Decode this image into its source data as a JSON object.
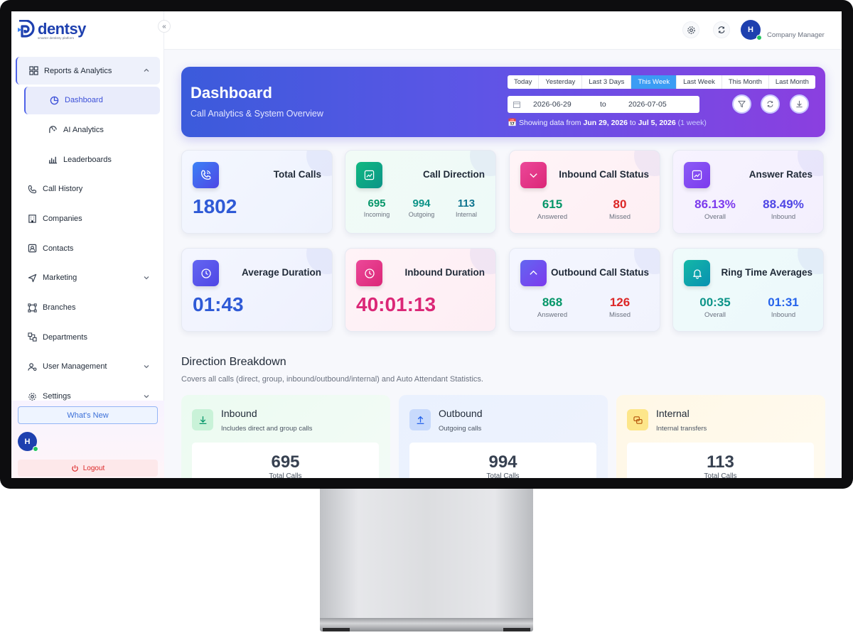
{
  "brand": {
    "name": "dentsy",
    "tagline": "smarter dentistry platform"
  },
  "sidebar": {
    "collapse_icon": "«",
    "items": [
      {
        "label": "Reports & Analytics",
        "icon": "grid-icon",
        "expanded": true
      },
      {
        "label": "Dashboard",
        "icon": "pie-chart-icon",
        "active": true
      },
      {
        "label": "AI Analytics",
        "icon": "ai-icon"
      },
      {
        "label": "Leaderboards",
        "icon": "bar-chart-icon"
      },
      {
        "label": "Call History",
        "icon": "phone-icon"
      },
      {
        "label": "Companies",
        "icon": "building-icon"
      },
      {
        "label": "Contacts",
        "icon": "contact-card-icon"
      },
      {
        "label": "Marketing",
        "icon": "send-icon"
      },
      {
        "label": "Branches",
        "icon": "branches-icon"
      },
      {
        "label": "Departments",
        "icon": "departments-icon"
      },
      {
        "label": "User Management",
        "icon": "user-gear-icon"
      },
      {
        "label": "Settings",
        "icon": "gear-icon"
      }
    ],
    "whats_new": "What's New",
    "avatar_initial": "H",
    "logout": "Logout"
  },
  "topbar": {
    "avatar_initial": "H",
    "role": "Company Manager"
  },
  "hero": {
    "title": "Dashboard",
    "subtitle": "Call Analytics & System Overview",
    "ranges": [
      "Today",
      "Yesterday",
      "Last 3 Days",
      "This Week",
      "Last Week",
      "This Month",
      "Last Month"
    ],
    "selected_range": "This Week",
    "date_from": "2026-06-29",
    "date_to_label": "to",
    "date_to": "2026-07-05",
    "showing_prefix": "Showing data from",
    "showing_from": "Jun 29, 2026",
    "showing_to_word": "to",
    "showing_to": "Jul 5, 2026",
    "showing_span": "(1 week)"
  },
  "cards": {
    "total_calls": {
      "title": "Total Calls",
      "value": "1802"
    },
    "call_direction": {
      "title": "Call Direction",
      "incoming": "695",
      "incoming_label": "Incoming",
      "outgoing": "994",
      "outgoing_label": "Outgoing",
      "internal": "113",
      "internal_label": "Internal"
    },
    "inbound_status": {
      "title": "Inbound Call Status",
      "answered": "615",
      "answered_label": "Answered",
      "missed": "80",
      "missed_label": "Missed"
    },
    "answer_rates": {
      "title": "Answer Rates",
      "overall": "86.13%",
      "overall_label": "Overall",
      "inbound": "88.49%",
      "inbound_label": "Inbound"
    },
    "average_duration": {
      "title": "Average Duration",
      "value": "01:43"
    },
    "inbound_duration": {
      "title": "Inbound Duration",
      "value": "40:01:13"
    },
    "outbound_status": {
      "title": "Outbound Call Status",
      "answered": "868",
      "answered_label": "Answered",
      "missed": "126",
      "missed_label": "Missed"
    },
    "ring_time": {
      "title": "Ring Time Averages",
      "overall": "00:35",
      "overall_label": "Overall",
      "inbound": "01:31",
      "inbound_label": "Inbound"
    }
  },
  "breakdown": {
    "title": "Direction Breakdown",
    "subtitle": "Covers all calls (direct, group, inbound/outbound/internal) and Auto Attendant Statistics.",
    "items": [
      {
        "title": "Inbound",
        "subtitle": "Includes direct and group calls",
        "value": "695",
        "label": "Total Calls"
      },
      {
        "title": "Outbound",
        "subtitle": "Outgoing calls",
        "value": "994",
        "label": "Total Calls"
      },
      {
        "title": "Internal",
        "subtitle": "Internal transfers",
        "value": "113",
        "label": "Total Calls"
      }
    ]
  },
  "colors": {
    "accent": "#4f63e8",
    "answered": "#059669",
    "missed": "#dc2626",
    "hero_start": "#3b5bdb",
    "hero_end": "#8b3fe0"
  }
}
